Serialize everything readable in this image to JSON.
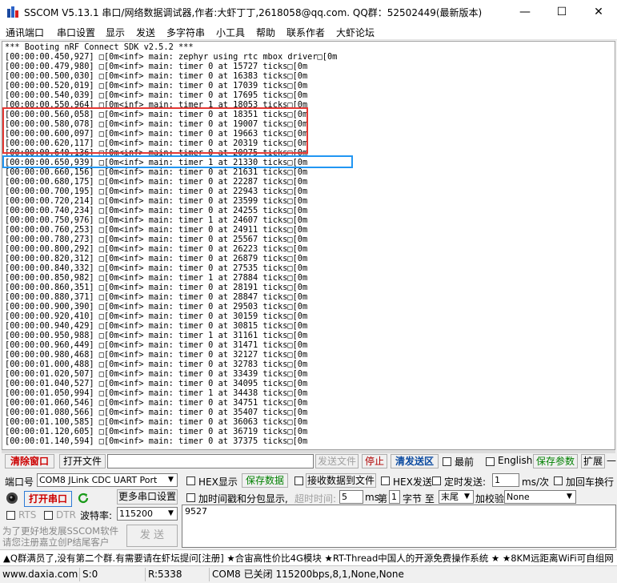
{
  "window": {
    "title": "SSCOM V5.13.1 串口/网络数据调试器,作者:大虾丁丁,2618058@qq.com. QQ群：52502449(最新版本)",
    "minimize": "—",
    "maximize": "☐",
    "close": "✕"
  },
  "menu": [
    "通讯端口",
    "串口设置",
    "显示",
    "发送",
    "多字符串",
    "小工具",
    "帮助",
    "联系作者",
    "大虾论坛"
  ],
  "log_lines": [
    "*** Booting nRF Connect SDK v2.5.2 ***",
    "[00:00:00.450,927] □[0m<inf> main: zephyr using rtc mbox driver□[0m",
    "[00:00:00.479,980] □[0m<inf> main: timer 0 at 15727 ticks□[0m",
    "[00:00:00.500,030] □[0m<inf> main: timer 0 at 16383 ticks□[0m",
    "[00:00:00.520,019] □[0m<inf> main: timer 0 at 17039 ticks□[0m",
    "[00:00:00.540,039] □[0m<inf> main: timer 0 at 17695 ticks□[0m",
    "[00:00:00.550,964] □[0m<inf> main: timer 1 at 18053 ticks□[0m",
    "[00:00:00.560,058] □[0m<inf> main: timer 0 at 18351 ticks□[0m",
    "[00:00:00.580,078] □[0m<inf> main: timer 0 at 19007 ticks□[0m",
    "[00:00:00.600,097] □[0m<inf> main: timer 0 at 19663 ticks□[0m",
    "[00:00:00.620,117] □[0m<inf> main: timer 0 at 20319 ticks□[0m",
    "[00:00:00.640,136] □[0m<inf> main: timer 0 at 20975 ticks□[0m",
    "[00:00:00.650,939] □[0m<inf> main: timer 1 at 21330 ticks□[0m",
    "[00:00:00.660,156] □[0m<inf> main: timer 0 at 21631 ticks□[0m",
    "[00:00:00.680,175] □[0m<inf> main: timer 0 at 22287 ticks□[0m",
    "[00:00:00.700,195] □[0m<inf> main: timer 0 at 22943 ticks□[0m",
    "[00:00:00.720,214] □[0m<inf> main: timer 0 at 23599 ticks□[0m",
    "[00:00:00.740,234] □[0m<inf> main: timer 0 at 24255 ticks□[0m",
    "[00:00:00.750,976] □[0m<inf> main: timer 1 at 24607 ticks□[0m",
    "[00:00:00.760,253] □[0m<inf> main: timer 0 at 24911 ticks□[0m",
    "[00:00:00.780,273] □[0m<inf> main: timer 0 at 25567 ticks□[0m",
    "[00:00:00.800,292] □[0m<inf> main: timer 0 at 26223 ticks□[0m",
    "[00:00:00.820,312] □[0m<inf> main: timer 0 at 26879 ticks□[0m",
    "[00:00:00.840,332] □[0m<inf> main: timer 0 at 27535 ticks□[0m",
    "[00:00:00.850,982] □[0m<inf> main: timer 1 at 27884 ticks□[0m",
    "[00:00:00.860,351] □[0m<inf> main: timer 0 at 28191 ticks□[0m",
    "[00:00:00.880,371] □[0m<inf> main: timer 0 at 28847 ticks□[0m",
    "[00:00:00.900,390] □[0m<inf> main: timer 0 at 29503 ticks□[0m",
    "[00:00:00.920,410] □[0m<inf> main: timer 0 at 30159 ticks□[0m",
    "[00:00:00.940,429] □[0m<inf> main: timer 0 at 30815 ticks□[0m",
    "[00:00:00.950,988] □[0m<inf> main: timer 1 at 31161 ticks□[0m",
    "[00:00:00.960,449] □[0m<inf> main: timer 0 at 31471 ticks□[0m",
    "[00:00:00.980,468] □[0m<inf> main: timer 0 at 32127 ticks□[0m",
    "[00:00:01.000,488] □[0m<inf> main: timer 0 at 32783 ticks□[0m",
    "[00:00:01.020,507] □[0m<inf> main: timer 0 at 33439 ticks□[0m",
    "[00:00:01.040,527] □[0m<inf> main: timer 0 at 34095 ticks□[0m",
    "[00:00:01.050,994] □[0m<inf> main: timer 1 at 34438 ticks□[0m",
    "[00:00:01.060,546] □[0m<inf> main: timer 0 at 34751 ticks□[0m",
    "[00:00:01.080,566] □[0m<inf> main: timer 0 at 35407 ticks□[0m",
    "[00:00:01.100,585] □[0m<inf> main: timer 0 at 36063 ticks□[0m",
    "[00:00:01.120,605] □[0m<inf> main: timer 0 at 36719 ticks□[0m",
    "[00:00:01.140,594] □[0m<inf> main: timer 0 at 37375 ticks□[0m"
  ],
  "highlights": {
    "red_color": "#e53935",
    "blue_color": "#2196f3"
  },
  "toolbar": {
    "clear_window": "清除窗口",
    "open_file": "打开文件",
    "send_file": "发送文件",
    "stop": "停止",
    "clear_send": "清发送区",
    "topmost": "最前",
    "english": "English",
    "save_params": "保存参数",
    "expand": "扩展",
    "collapse": "—"
  },
  "port_panel": {
    "port_label": "端口号",
    "port_value": "COM8 JLink CDC UART Port",
    "more_settings": "更多串口设置",
    "open_port": "打开串口",
    "rts": "RTS",
    "dtr": "DTR",
    "baud_label": "波特率:",
    "baud_value": "115200",
    "promo_line1": "为了更好地发展SSCOM软件",
    "promo_line2": "请您注册嘉立创P结尾客户",
    "send_button": "发 送"
  },
  "options": {
    "hex_display": "HEX显示",
    "save_data": "保存数据",
    "recv_to_file": "接收数据到文件",
    "hex_send": "HEX发送",
    "timed_send": "定时发送:",
    "timed_value": "1",
    "ms_per": "ms/次",
    "add_crlf": "加回车换行",
    "timestamp_split": "加时间戳和分包显示,",
    "timeout_label": "超时时间:",
    "timeout_value": "5",
    "ms": "ms",
    "nth_label": "第",
    "nth_value": "1",
    "byte_label": "字节 至",
    "end_value": "末尾",
    "checksum_label": "加校验",
    "checksum_value": "None"
  },
  "send_area": {
    "text": "9527"
  },
  "ticker": "▲Q群满员了,没有第二个群.有需要请在虾坛提问[注册] ★合宙高性价比4G模块 ★RT-Thread中国人的开源免费操作系统 ★ ★8KM远距离WiFi可自组网",
  "status": {
    "website": "www.daxia.com",
    "s_count": "S:0",
    "r_count": "R:5338",
    "port_state": "COM8 已关闭  115200bps,8,1,None,None"
  }
}
